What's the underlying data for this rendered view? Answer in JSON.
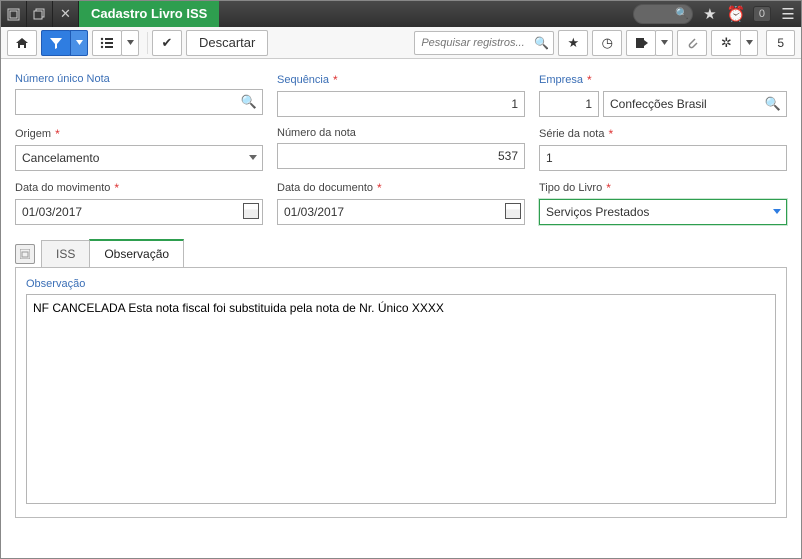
{
  "topbar": {
    "title": "Cadastro Livro ISS",
    "badge": "0",
    "search_placeholder": ""
  },
  "toolbar": {
    "discard_label": "Descartar",
    "search_placeholder": "Pesquisar registros...",
    "count": "5"
  },
  "form": {
    "numero_unico": {
      "label": "Número único Nota",
      "value": ""
    },
    "sequencia": {
      "label": "Sequência",
      "value": "1"
    },
    "empresa": {
      "label": "Empresa",
      "code": "1",
      "name": "Confecções Brasil"
    },
    "origem": {
      "label": "Origem",
      "value": "Cancelamento"
    },
    "numero_nota": {
      "label": "Número da nota",
      "value": "537"
    },
    "serie_nota": {
      "label": "Série da nota",
      "value": "1"
    },
    "data_mov": {
      "label": "Data do movimento",
      "value": "01/03/2017"
    },
    "data_doc": {
      "label": "Data do documento",
      "value": "01/03/2017"
    },
    "tipo_livro": {
      "label": "Tipo do Livro",
      "value": "Serviços Prestados"
    }
  },
  "tabs": {
    "items": [
      "ISS",
      "Observação"
    ],
    "active": 1
  },
  "observacao": {
    "label": "Observação",
    "value": "NF CANCELADA Esta nota fiscal foi substituida pela nota de Nr. Único XXXX"
  }
}
